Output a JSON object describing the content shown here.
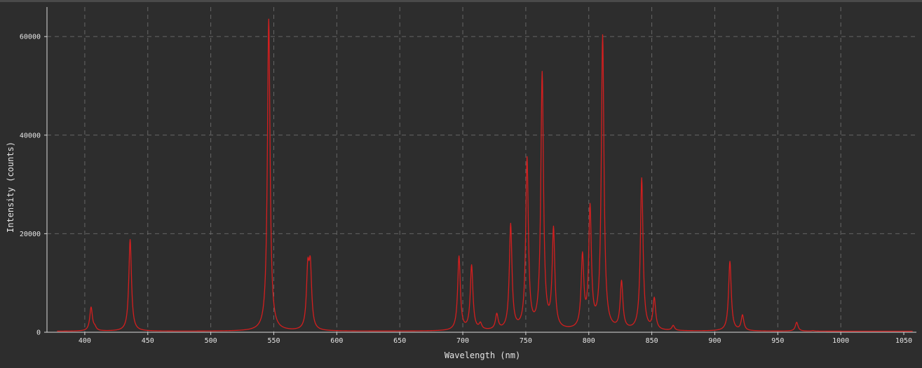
{
  "chart_data": {
    "type": "line",
    "title": "",
    "xlabel": "Wavelength (nm)",
    "ylabel": "Intensity (counts)",
    "xlim": [
      370,
      1060
    ],
    "ylim": [
      0,
      66000
    ],
    "x_ticks": [
      400,
      450,
      500,
      550,
      600,
      650,
      700,
      750,
      800,
      850,
      900,
      950,
      1000,
      1050
    ],
    "y_ticks": [
      0,
      20000,
      40000,
      60000
    ],
    "x_tick_labels": [
      "400",
      "450",
      "500",
      "550",
      "600",
      "650",
      "700",
      "750",
      "800",
      "850",
      "900",
      "950",
      "1000",
      "1050"
    ],
    "y_tick_labels": [
      "0",
      "20000",
      "40000",
      "60000"
    ],
    "grid": true,
    "legend": "none",
    "line_color": "#d41f1f",
    "background_color": "#2d2d2d",
    "grid_color": "#7a7a7a",
    "axis_color": "#d9d9d9",
    "x_range": [
      378,
      1057
    ],
    "baseline": 200,
    "series": [
      {
        "peaks": [
          {
            "x": 405,
            "y": 5000
          },
          {
            "x": 408,
            "y": 800
          },
          {
            "x": 436,
            "y": 18800
          },
          {
            "x": 546,
            "y": 63500
          },
          {
            "x": 577,
            "y": 11500
          },
          {
            "x": 579,
            "y": 12000
          },
          {
            "x": 697,
            "y": 15200
          },
          {
            "x": 707,
            "y": 13300
          },
          {
            "x": 714,
            "y": 1400
          },
          {
            "x": 727,
            "y": 3300
          },
          {
            "x": 738,
            "y": 21500
          },
          {
            "x": 751,
            "y": 34700
          },
          {
            "x": 763,
            "y": 52000
          },
          {
            "x": 772,
            "y": 20200
          },
          {
            "x": 795,
            "y": 14700
          },
          {
            "x": 801,
            "y": 24400
          },
          {
            "x": 811,
            "y": 59700
          },
          {
            "x": 826,
            "y": 9800
          },
          {
            "x": 842,
            "y": 31000
          },
          {
            "x": 852,
            "y": 6500
          },
          {
            "x": 867,
            "y": 1200
          },
          {
            "x": 912,
            "y": 14300
          },
          {
            "x": 922,
            "y": 3300
          },
          {
            "x": 965,
            "y": 2000
          },
          {
            "x": 978,
            "y": 300
          }
        ]
      }
    ]
  }
}
